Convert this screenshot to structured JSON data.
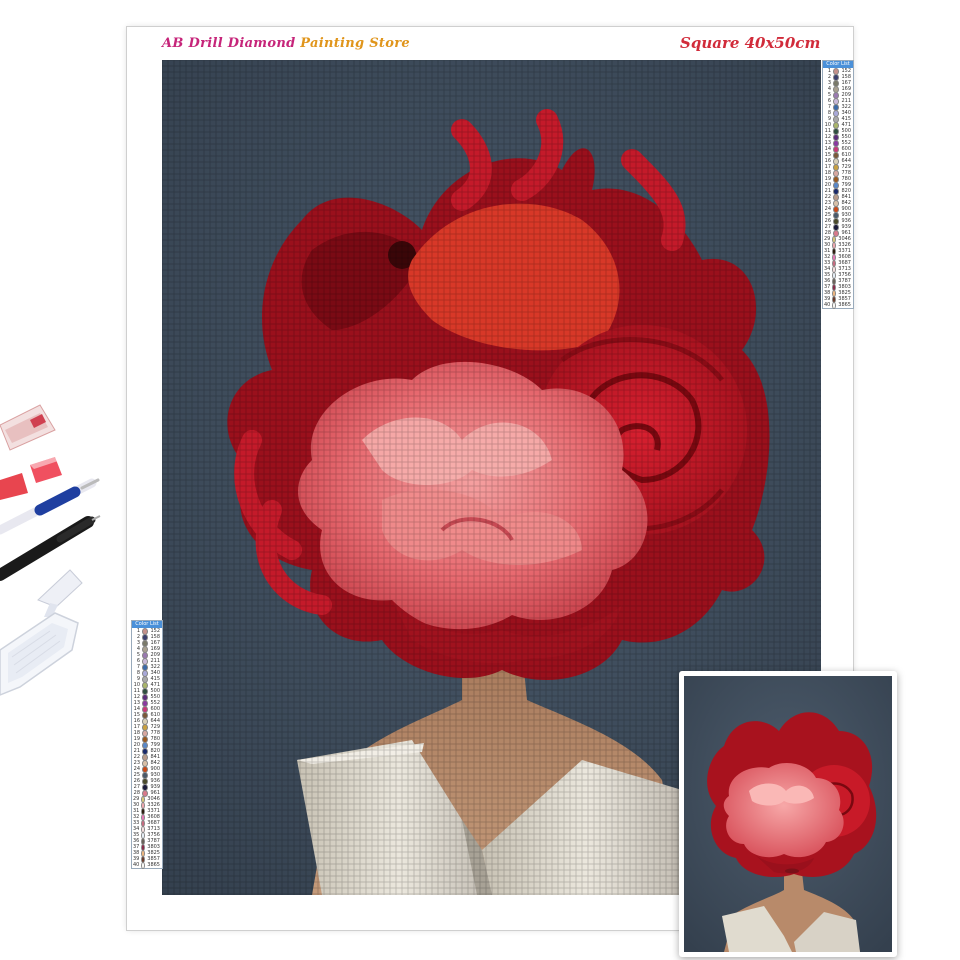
{
  "store": {
    "name_part1": "AB Drill Diamond",
    "name_part2": "Painting Store"
  },
  "size_label": "Square 40x50cm",
  "legend": {
    "title": "Color List",
    "entries": [
      {
        "n": "1",
        "code": "152",
        "color": "#c4908a"
      },
      {
        "n": "2",
        "code": "158",
        "color": "#3b3f6e"
      },
      {
        "n": "3",
        "code": "167",
        "color": "#7a7a6a"
      },
      {
        "n": "4",
        "code": "169",
        "color": "#a8a090"
      },
      {
        "n": "5",
        "code": "209",
        "color": "#9a7ab0"
      },
      {
        "n": "6",
        "code": "211",
        "color": "#c8b8d8"
      },
      {
        "n": "7",
        "code": "322",
        "color": "#3c6aa8"
      },
      {
        "n": "8",
        "code": "340",
        "color": "#a9a9d9"
      },
      {
        "n": "9",
        "code": "415",
        "color": "#a8a8a8"
      },
      {
        "n": "10",
        "code": "471",
        "color": "#a9b56a"
      },
      {
        "n": "11",
        "code": "500",
        "color": "#2f4f3f"
      },
      {
        "n": "12",
        "code": "550",
        "color": "#5c2c7a"
      },
      {
        "n": "13",
        "code": "552",
        "color": "#8a3aa0"
      },
      {
        "n": "14",
        "code": "600",
        "color": "#c83a78"
      },
      {
        "n": "15",
        "code": "610",
        "color": "#7a5a3a"
      },
      {
        "n": "16",
        "code": "644",
        "color": "#d8d0b8"
      },
      {
        "n": "17",
        "code": "729",
        "color": "#c8a040"
      },
      {
        "n": "18",
        "code": "778",
        "color": "#d8a8a0"
      },
      {
        "n": "19",
        "code": "780",
        "color": "#9a5a20"
      },
      {
        "n": "20",
        "code": "799",
        "color": "#5a88c8"
      },
      {
        "n": "21",
        "code": "820",
        "color": "#1a2a6a"
      },
      {
        "n": "22",
        "code": "841",
        "color": "#b89a88"
      },
      {
        "n": "23",
        "code": "842",
        "color": "#d8c0a8"
      },
      {
        "n": "24",
        "code": "900",
        "color": "#c84a1a"
      },
      {
        "n": "25",
        "code": "930",
        "color": "#4a5a6a"
      },
      {
        "n": "26",
        "code": "936",
        "color": "#4a4a2a"
      },
      {
        "n": "27",
        "code": "939",
        "color": "#1a1a3a"
      },
      {
        "n": "28",
        "code": "961",
        "color": "#d87a8a"
      },
      {
        "n": "29",
        "code": "3046",
        "color": "#d8c878"
      },
      {
        "n": "30",
        "code": "3326",
        "color": "#f0a8b0"
      },
      {
        "n": "31",
        "code": "3371",
        "color": "#2a1a0a"
      },
      {
        "n": "32",
        "code": "3608",
        "color": "#e878b8"
      },
      {
        "n": "33",
        "code": "3687",
        "color": "#c86a80"
      },
      {
        "n": "34",
        "code": "3713",
        "color": "#f8e0e0"
      },
      {
        "n": "35",
        "code": "3756",
        "color": "#e8f0f8"
      },
      {
        "n": "36",
        "code": "3787",
        "color": "#6a6258"
      },
      {
        "n": "37",
        "code": "3803",
        "color": "#8a2a4a"
      },
      {
        "n": "38",
        "code": "3825",
        "color": "#f0b880"
      },
      {
        "n": "39",
        "code": "3857",
        "color": "#6a3a2a"
      },
      {
        "n": "40",
        "code": "3865",
        "color": "#fafaf8"
      }
    ]
  },
  "colors": {
    "background_blue": "#3f4e5e",
    "flower_red": "#c41a2a",
    "flower_pink": "#e8646a",
    "shirt": "#d9d4c8",
    "skin": "#b98a6a"
  }
}
